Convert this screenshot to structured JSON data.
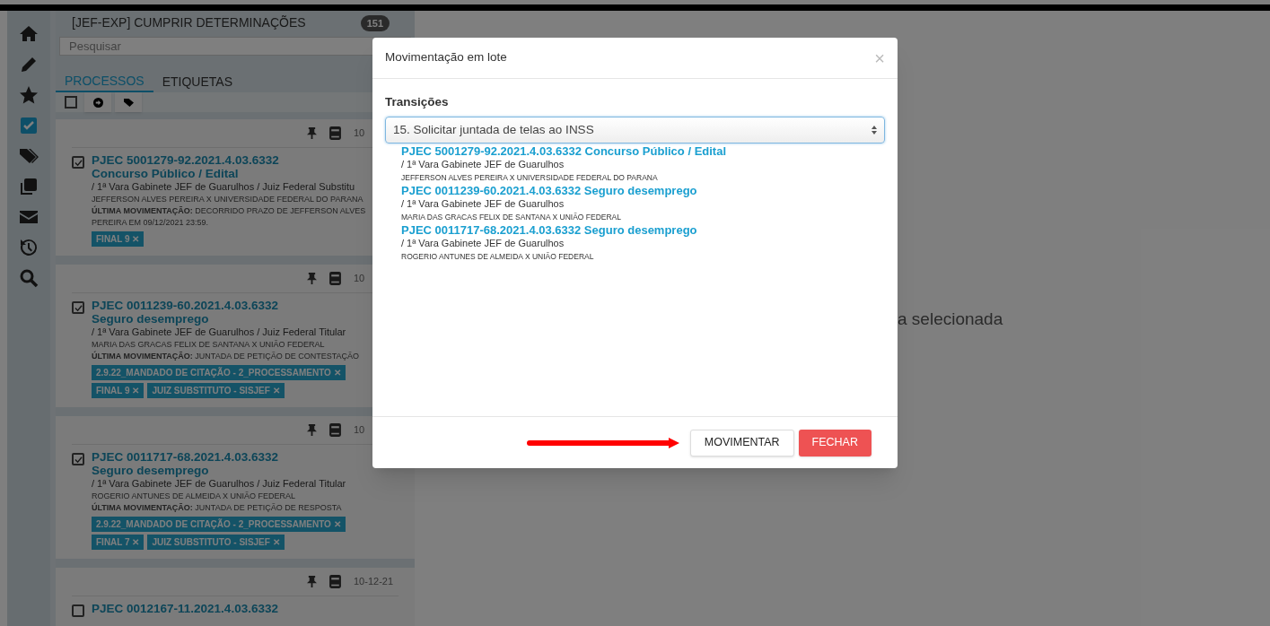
{
  "sidebar": {
    "items": [
      {
        "selected": false
      },
      {
        "selected": false
      },
      {
        "selected": false
      },
      {
        "selected": true
      },
      {
        "selected": false
      },
      {
        "selected": false
      },
      {
        "selected": false
      },
      {
        "selected": false
      },
      {
        "selected": false
      }
    ]
  },
  "task": {
    "title": "[JEF-EXP] CUMPRIR DETERMINAÇÕES",
    "count": "151",
    "search_placeholder": "Pesquisar"
  },
  "tabs": [
    {
      "label": "PROCESSOS",
      "selected": true
    },
    {
      "label": "ETIQUETAS",
      "selected": false
    }
  ],
  "select_all": {
    "checked": false
  },
  "processes": [
    {
      "date": "10",
      "checked": true,
      "number": "PJEC 5001279-92.2021.4.03.6332",
      "subject": "Concurso Público / Edital",
      "court": "/ 1ª Vara Gabinete JEF de Guarulhos / Juiz Federal Substitu",
      "parties": "JEFFERSON ALVES PEREIRA X UNIVERSIDADE FEDERAL DO PARANA",
      "last_move": [
        "**ÚLTIMA MOVIMENTAÇÃO:** DECORRIDO PRAZO DE JEFFERSON ALVES",
        "PEREIRA EM 09/12/2021 23:59."
      ],
      "tags": [
        [
          "FINAL 9 ✕"
        ]
      ]
    },
    {
      "date": "10",
      "checked": true,
      "number": "PJEC 0011239-60.2021.4.03.6332",
      "subject": "Seguro desemprego",
      "court": "/ 1ª Vara Gabinete JEF de Guarulhos / Juiz Federal Titular",
      "parties": "MARIA DAS GRACAS FELIX DE SANTANA X UNIÃO FEDERAL",
      "last_move": [
        "**ÚLTIMA MOVIMENTAÇÃO:** JUNTADA DE PETIÇÃO DE CONTESTAÇÃO"
      ],
      "tags": [
        [
          "2.9.22_MANDADO DE CITAÇÃO - 2_PROCESSAMENTO ✕"
        ],
        [
          "FINAL 9 ✕",
          "JUIZ SUBSTITUTO - SISJEF ✕"
        ]
      ]
    },
    {
      "date": "10",
      "checked": true,
      "number": "PJEC 0011717-68.2021.4.03.6332",
      "subject": "Seguro desemprego",
      "court": "/ 1ª Vara Gabinete JEF de Guarulhos / Juiz Federal Titular",
      "parties": "ROGERIO ANTUNES DE ALMEIDA X UNIÃO FEDERAL",
      "last_move": [
        "**ÚLTIMA MOVIMENTAÇÃO:** JUNTADA DE PETIÇÃO DE RESPOSTA"
      ],
      "tags": [
        [
          "2.9.22_MANDADO DE CITAÇÃO - 2_PROCESSAMENTO ✕"
        ],
        [
          "FINAL 7 ✕",
          "JUIZ SUBSTITUTO - SISJEF ✕"
        ]
      ]
    },
    {
      "date": "10-12-21",
      "checked": false,
      "number": "PJEC 0012167-11.2021.4.03.6332"
    }
  ],
  "background_text": "a selecionada",
  "modal": {
    "title": "Movimentação em lote",
    "close": "×",
    "transitions_label": "Transições",
    "transition": "15. Solicitar juntada de telas ao INSS",
    "items": [
      {
        "title": "PJEC 5001279-92.2021.4.03.6332 Concurso Público / Edital",
        "court": "/ 1ª Vara Gabinete JEF de Guarulhos",
        "parties": "JEFFERSON ALVES PEREIRA X UNIVERSIDADE FEDERAL DO PARANA"
      },
      {
        "title": "PJEC 0011239-60.2021.4.03.6332 Seguro desemprego",
        "court": "/ 1ª Vara Gabinete JEF de Guarulhos",
        "parties": "MARIA DAS GRACAS FELIX DE SANTANA X UNIÃO FEDERAL"
      },
      {
        "title": "PJEC 0011717-68.2021.4.03.6332 Seguro desemprego",
        "court": "/ 1ª Vara Gabinete JEF de Guarulhos",
        "parties": "ROGERIO ANTUNES DE ALMEIDA X UNIÃO FEDERAL"
      }
    ],
    "buttons": [
      {
        "label": "MOVIMENTAR",
        "kind": "default"
      },
      {
        "label": "FECHAR",
        "kind": "danger"
      }
    ]
  }
}
